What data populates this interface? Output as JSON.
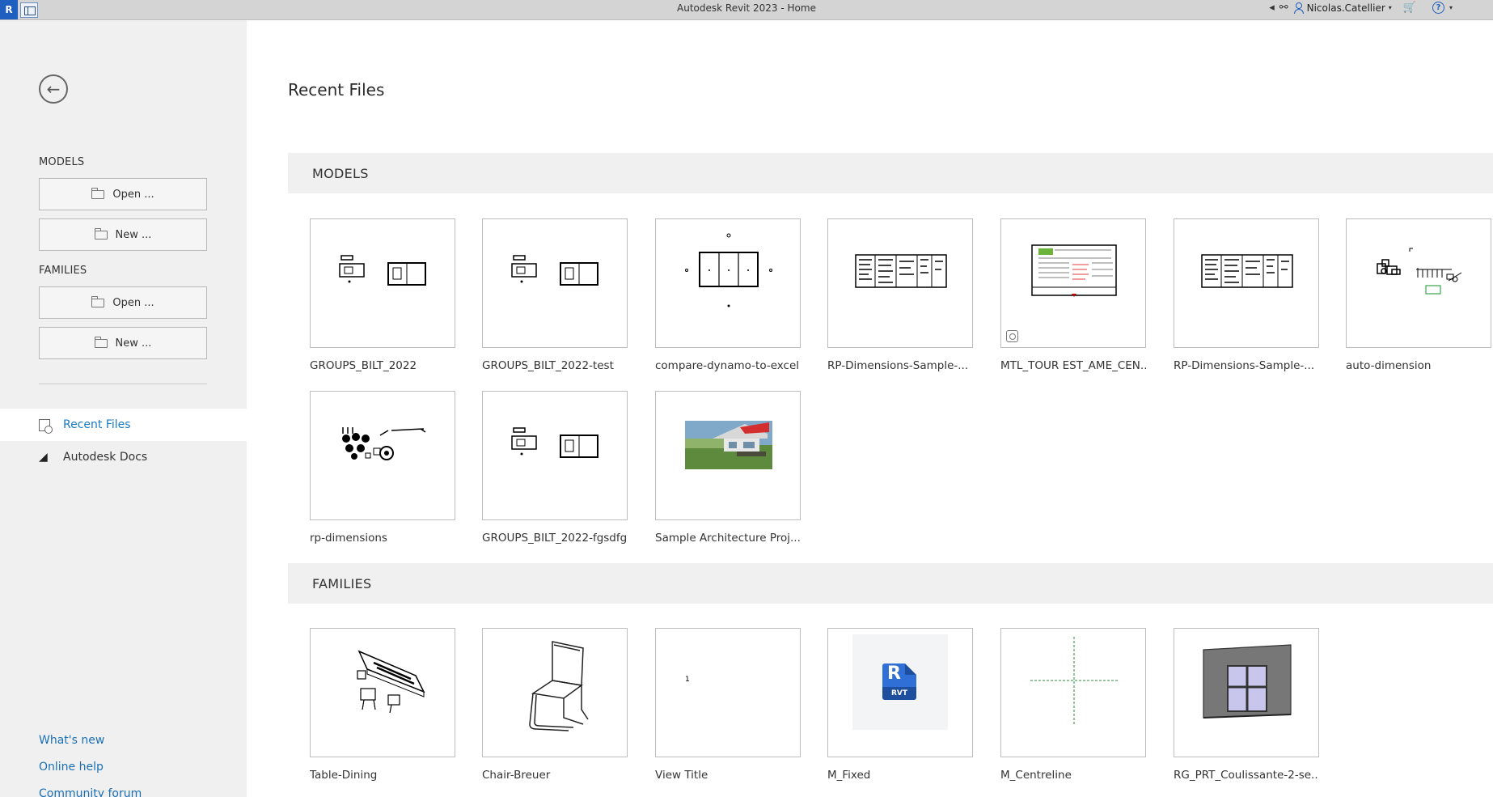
{
  "titlebar": {
    "logo": "R",
    "title": "Autodesk Revit 2023 - Home",
    "user": "Nicolas.Catellier",
    "icons": [
      "revit-logo-icon",
      "quick-access-icon",
      "collapse-arrow-icon",
      "binoculars-icon",
      "user-icon",
      "cart-icon",
      "help-icon"
    ]
  },
  "sidebar": {
    "back_glyph": "←",
    "models_label": "MODELS",
    "families_label": "FAMILIES",
    "models_open": "Open ...",
    "models_new": "New ...",
    "families_open": "Open ...",
    "families_new": "New ...",
    "nav": [
      {
        "label": "Recent Files",
        "active": true
      },
      {
        "label": "Autodesk Docs",
        "active": false
      }
    ],
    "footer": [
      "What's new",
      "Online help",
      "Community forum"
    ]
  },
  "main": {
    "title": "Recent Files",
    "models_header": "MODELS",
    "families_header": "FAMILIES",
    "models": [
      "GROUPS_BILT_2022",
      "GROUPS_BILT_2022-test",
      "compare-dynamo-to-excel",
      "RP-Dimensions-Sample-...",
      "MTL_TOUR EST_AME_CEN...",
      "RP-Dimensions-Sample-...",
      "auto-dimension",
      "rp-dimensions",
      "GROUPS_BILT_2022-fgsdfg",
      "Sample Architecture Proj..."
    ],
    "families": [
      "Table-Dining",
      "Chair-Breuer",
      "View Title",
      "M_Fixed",
      "M_Centreline",
      "RG_PRT_Coulissante-2-se..."
    ],
    "rvt_badge": "RVT",
    "rvt_letter": "R",
    "view_title_number": "1"
  },
  "colors": {
    "accent": "#1a7ac4",
    "link": "#1a6fb5",
    "sidebar_bg": "#f0f0f0",
    "band_bg": "#f0f0f0",
    "revit_blue": "#1f5fbf"
  }
}
